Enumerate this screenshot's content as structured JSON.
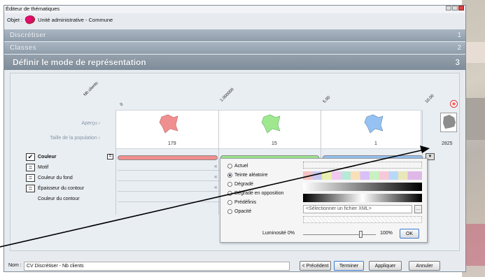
{
  "window": {
    "title": "Éditeur de thématiques"
  },
  "object": {
    "label": "Objet :",
    "value": "Unité administrative - Commune"
  },
  "steps": [
    {
      "label": "Discrétiser",
      "num": "1"
    },
    {
      "label": "Classes",
      "num": "2"
    },
    {
      "label": "Définir le mode de représentation",
      "num": "3"
    }
  ],
  "columns": {
    "first": "Nb clients",
    "headers": [
      "0",
      "1.000000",
      "5.00",
      "10.00"
    ]
  },
  "rowlabels": {
    "preview": "Aperçu ›",
    "population": "Taille de la population ›"
  },
  "population": [
    "179",
    "15",
    "1",
    "2825"
  ],
  "properties": [
    "Couleur",
    "Motif",
    "Couleur du fond",
    "Épaisseur du contour",
    "Couleur du contour"
  ],
  "popup": {
    "options": [
      "Actuel",
      "Teinte aléatoire",
      "Dégradé",
      "Dégradé en opposition",
      "Prédéfinis",
      "Opacité"
    ],
    "xml_placeholder": "<Sélectionner un fichier XML>",
    "luminosity_label": "Luminosité",
    "lum_min": "0%",
    "lum_max": "100%",
    "lum_value": 0.8,
    "ok": "OK"
  },
  "footer": {
    "name_label": "Nom :",
    "name_value": "CV Discrétiser - Nb clients",
    "prev": "< Précédent",
    "finish": "Terminer",
    "apply": "Appliquer",
    "cancel": "Annuler"
  },
  "colors": {
    "class1": "#f08f8f",
    "class2": "#9fe88f",
    "class3": "#95c2f2",
    "grey": "#8d8d8d"
  }
}
